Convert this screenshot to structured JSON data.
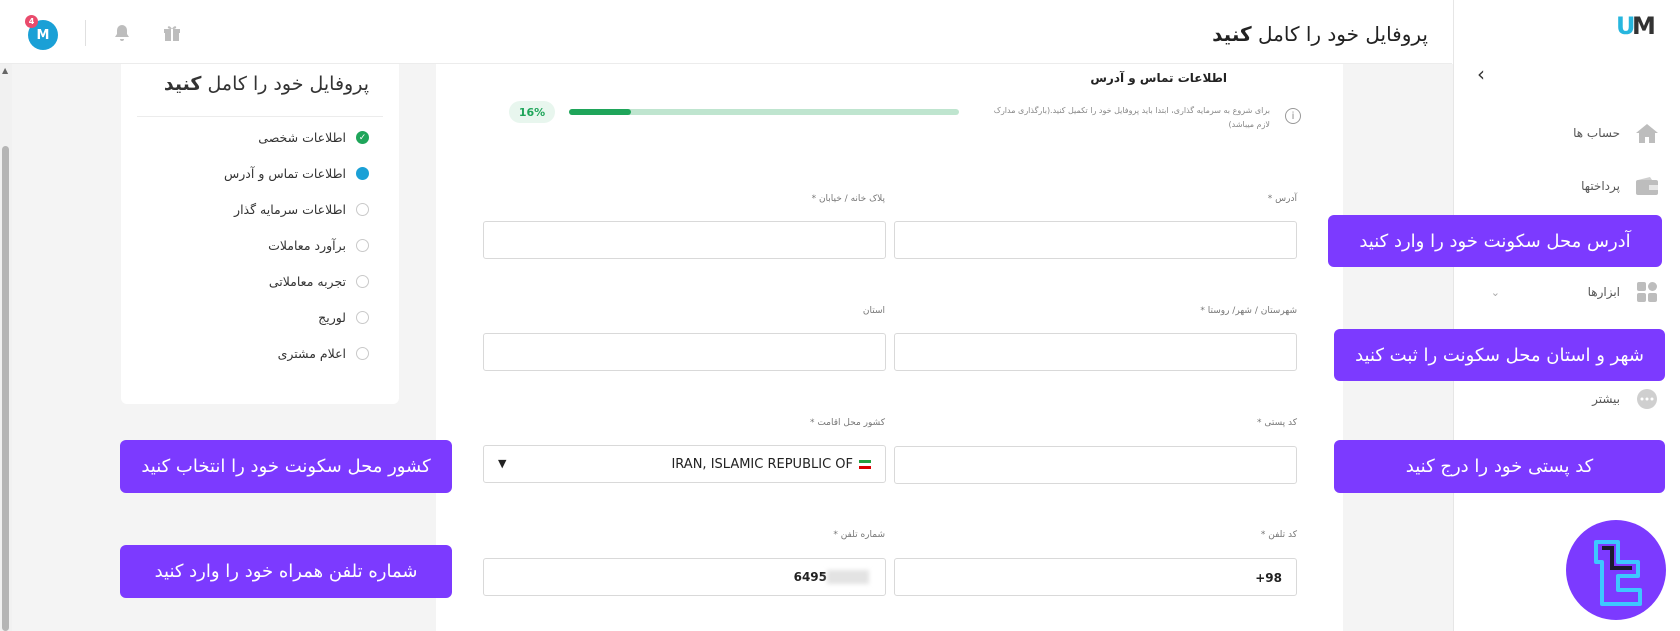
{
  "header": {
    "title_prefix": "پروفایل خود را کامل",
    "title_bold": "کنید",
    "avatar_letter": "M",
    "notification_count": "4"
  },
  "sidebar": {
    "logo_u": "U",
    "logo_m": "M",
    "collapse_glyph": "‹",
    "items": [
      {
        "label": "حساب ها",
        "icon": "home-icon"
      },
      {
        "label": "پرداختها",
        "icon": "wallet-icon"
      },
      {
        "label": "ابزارها",
        "icon": "grid-icon"
      },
      {
        "label": "بیشتر",
        "icon": "more-icon"
      }
    ]
  },
  "steps": {
    "title_prefix": "پروفایل خود را کامل",
    "title_bold": "کنید",
    "items": [
      {
        "label": "اطلاعات شخصی",
        "state": "done"
      },
      {
        "label": "اطلاعات تماس و آدرس",
        "state": "active"
      },
      {
        "label": "اطلاعات سرمایه گذار",
        "state": "pending"
      },
      {
        "label": "برآورد معاملات",
        "state": "pending"
      },
      {
        "label": "تجربه معاملاتی",
        "state": "pending"
      },
      {
        "label": "لوریج",
        "state": "pending"
      },
      {
        "label": "اعلام مشتری",
        "state": "pending"
      }
    ]
  },
  "form": {
    "section_title": "اطلاعات تماس و آدرس",
    "info_text": "برای شروع به سرمایه گذاری، ابتدا باید پروفایل خود را تکمیل کنید.(بارگذاری مدارک لازم میباشد)",
    "progress_percent": 16,
    "progress_label": "16%",
    "fields": {
      "address": {
        "label": "آدرس *",
        "value": ""
      },
      "plaque": {
        "label": "پلاک خانه / خیابان *",
        "value": ""
      },
      "city": {
        "label": "شهرستان / شهر/ روستا *",
        "value": ""
      },
      "province": {
        "label": "استان",
        "value": ""
      },
      "postal": {
        "label": "کد پستی *",
        "value": ""
      },
      "country": {
        "label": "کشور محل اقامت *",
        "value": "IRAN, ISLAMIC REPUBLIC OF"
      },
      "phone_code": {
        "label": "کد تلفن *",
        "value": "+98"
      },
      "phone": {
        "label": "شماره تلفن *",
        "value": "6495"
      }
    }
  },
  "callouts": {
    "address": "آدرس محل سکونت خود را وارد کنید",
    "city": "شهر و استان محل سکونت را ثبت کنید",
    "postal": "کد پستی خود را درج کنید",
    "country": "کشور محل سکونت خود را انتخاب کنید",
    "phone": "شماره تلفن همراه خود را وارد کنید"
  },
  "colors": {
    "accent": "#1aa0d6",
    "success": "#1fa55a",
    "callout": "#7c3aff"
  }
}
